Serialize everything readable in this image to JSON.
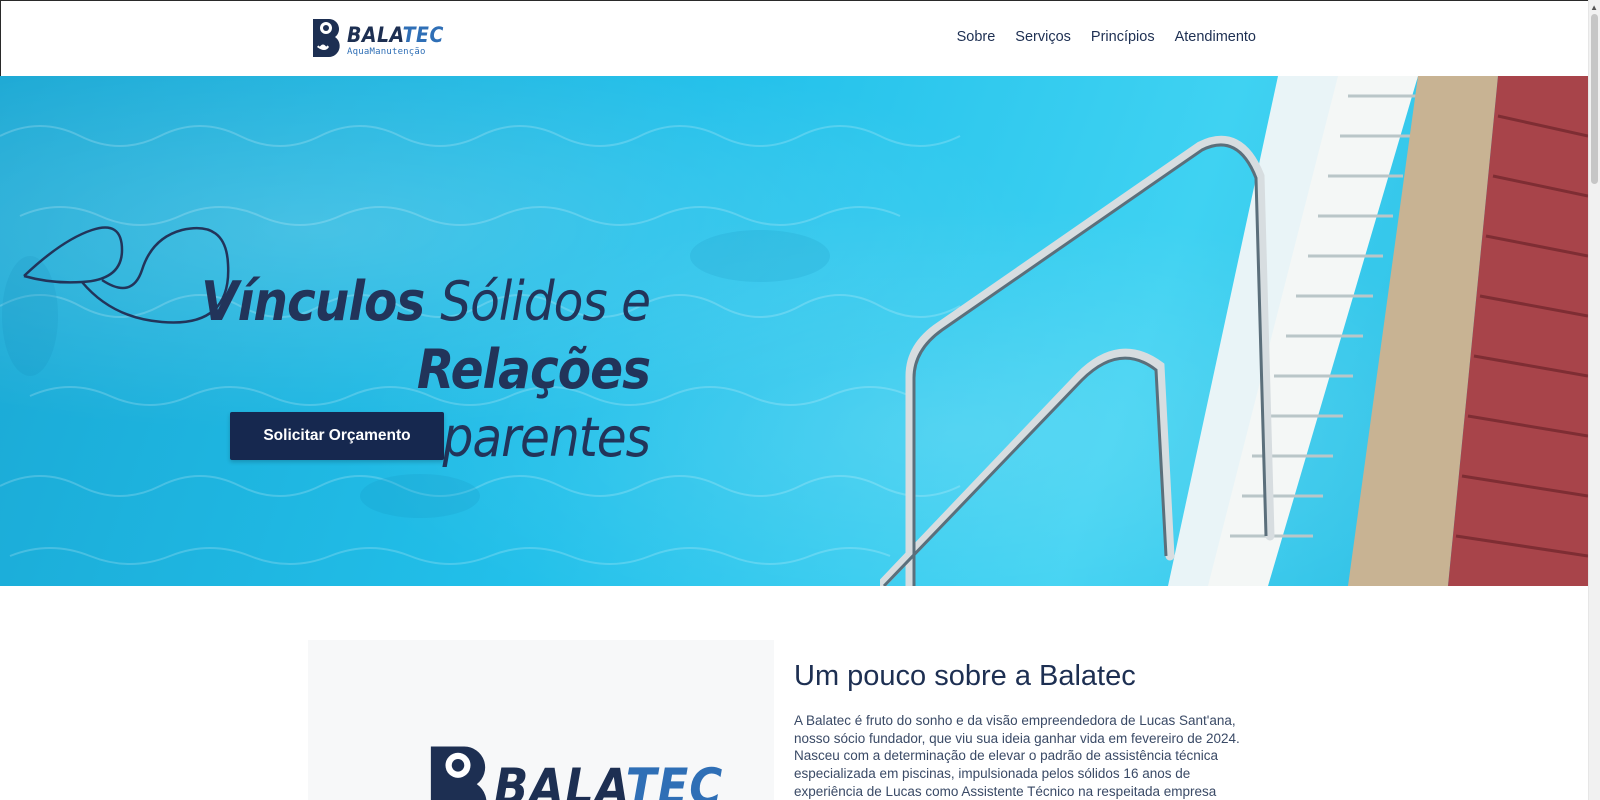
{
  "header": {
    "logo": {
      "word_part1": "BALA",
      "word_part2": "TEC",
      "subtitle": "AquaManutenção"
    },
    "nav": [
      "Sobre",
      "Serviços",
      "Princípios",
      "Atendimento"
    ]
  },
  "hero": {
    "title_line1_strong": "Vínculos",
    "title_line1_light": "Sólidos e",
    "title_line2_strong": "Relações",
    "title_line2_light": "Transparentes",
    "cta_label": "Solicitar Orçamento"
  },
  "about": {
    "logo": {
      "word_part1": "BALA",
      "word_part2": "TEC"
    },
    "title": "Um pouco sobre a Balatec",
    "text": "A Balatec é fruto do sonho e da visão empreendedora de Lucas Sant'ana, nosso sócio fundador, que viu sua ideia ganhar vida em fevereiro de 2024. Nasceu com a determinação de elevar o padrão de assistência técnica especializada em piscinas, impulsionada pelos sólidos 16 anos de experiência de Lucas como Assistente Técnico na respeitada empresa"
  },
  "colors": {
    "navy": "#16284f",
    "brand_blue": "#2f6fb6",
    "water": "#22c0ea"
  },
  "icons": {
    "logo_mark": "gear-wave-b-icon",
    "hero_wave": "wave-icon"
  }
}
